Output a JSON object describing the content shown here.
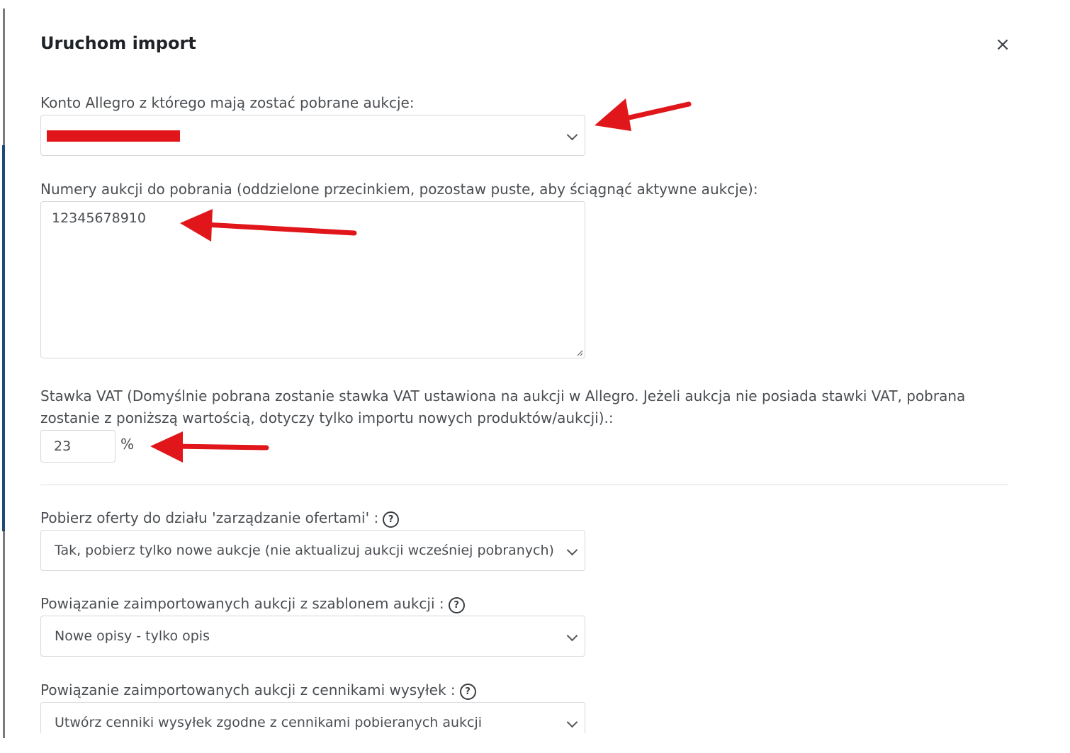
{
  "modal": {
    "title": "Uruchom import",
    "close_icon": "close-icon"
  },
  "account": {
    "label": "Konto Allegro z którego mają zostać pobrane aukcje:",
    "value": "",
    "value_redacted": true
  },
  "auction_numbers": {
    "label": "Numery aukcji do pobrania (oddzielone przecinkiem, pozostaw puste, aby ściągnąć aktywne aukcje):",
    "value": "12345678910"
  },
  "vat": {
    "label_line1": "Stawka VAT (Domyślnie pobrana zostanie stawka VAT ustawiona na aukcji w Allegro. Jeżeli aukcja nie posiada stawki VAT, pobrana",
    "label_line2": "zostanie z poniższą wartością, dotyczy tylko importu nowych produktów/aukcji).:",
    "value": "23",
    "unit": "%"
  },
  "offers_section": {
    "label": "Pobierz oferty do działu 'zarządzanie ofertami' :",
    "value": "Tak, pobierz tylko nowe aukcje (nie aktualizuj aukcji wcześniej pobranych)",
    "help_icon": "help-icon"
  },
  "template_link": {
    "label": "Powiązanie zaimportowanych aukcji z szablonem aukcji :",
    "value": "Nowe opisy - tylko opis",
    "help_icon": "help-icon"
  },
  "shipping_link": {
    "label": "Powiązanie zaimportowanych aukcji z cennikami wysyłek :",
    "value": "Utwórz cenniki wysyłek zgodne z cennikami pobieranych aukcji",
    "help_icon": "help-icon"
  },
  "annotations": {
    "arrow_color": "#e0161b"
  }
}
